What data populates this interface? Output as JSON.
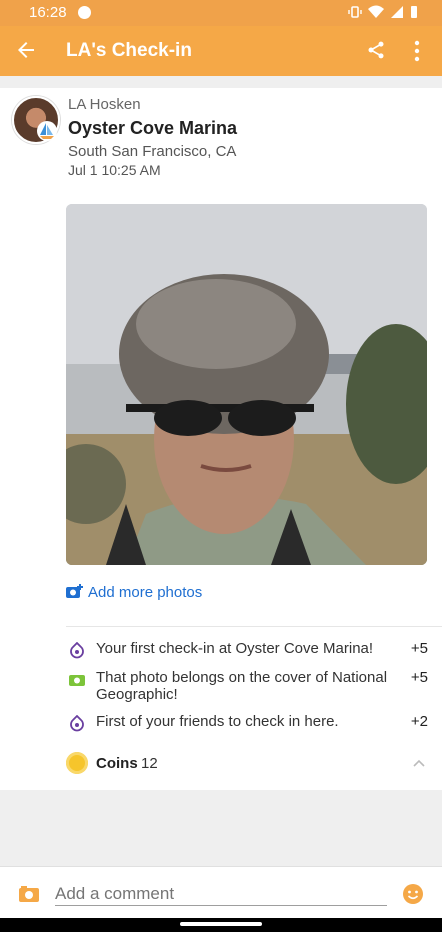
{
  "status": {
    "time": "16:28"
  },
  "appbar": {
    "title": "LA's Check-in"
  },
  "checkin": {
    "user": "LA Hosken",
    "venue": "Oyster Cove Marina",
    "location": "South San Francisco, CA",
    "datetime": "Jul 1 10:25 AM"
  },
  "add_photos_label": "Add more photos",
  "rewards": [
    {
      "text": "Your first check-in at Oyster Cove Marina!",
      "points": "+5",
      "icon": "check-in-icon"
    },
    {
      "text": "That photo belongs on the cover of National Geographic!",
      "points": "+5",
      "icon": "photo-reward-icon"
    },
    {
      "text": "First of your friends to check in here.",
      "points": "+2",
      "icon": "friends-icon"
    }
  ],
  "coins": {
    "label": "Coins",
    "count": "12"
  },
  "composer": {
    "placeholder": "Add a comment"
  },
  "colors": {
    "accent": "#f5a847",
    "link": "#1f6fd1",
    "reward_purple": "#6a3fa0",
    "reward_green": "#7cc43a"
  }
}
